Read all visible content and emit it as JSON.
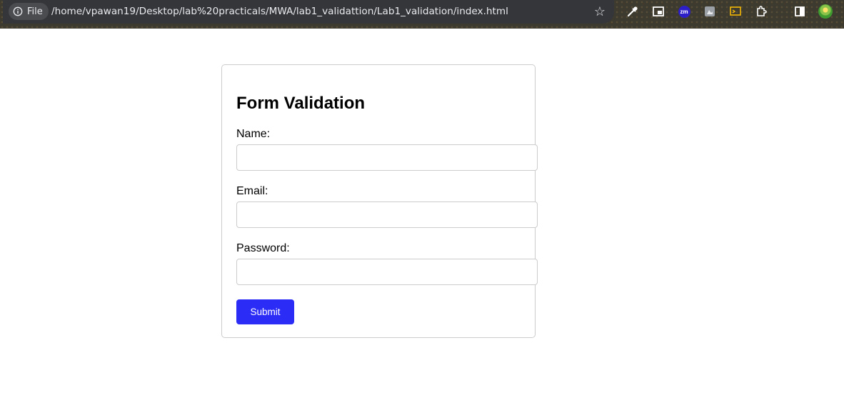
{
  "browser": {
    "scheme_chip": "File",
    "url": "/home/vpawan19/Desktop/lab%20practicals/MWA/lab1_validattion/Lab1_validation/index.html",
    "extensions": [
      {
        "name": "color-picker-icon"
      },
      {
        "name": "picture-in-picture-icon"
      },
      {
        "name": "zoom-extension-icon",
        "label": "zm"
      },
      {
        "name": "screenshot-extension-icon"
      },
      {
        "name": "cast-media-icon"
      },
      {
        "name": "extensions-puzzle-icon"
      },
      {
        "name": "side-panel-icon"
      },
      {
        "name": "profile-avatar"
      }
    ]
  },
  "form": {
    "title": "Form Validation",
    "fields": [
      {
        "label": "Name:",
        "value": "",
        "placeholder": ""
      },
      {
        "label": "Email:",
        "value": "",
        "placeholder": ""
      },
      {
        "label": "Password:",
        "value": "",
        "placeholder": ""
      }
    ],
    "submit_label": "Submit"
  },
  "colors": {
    "submit_button": "#2b2cf5",
    "card_border": "#cccccc",
    "toolbar_bg": "#35363a"
  }
}
